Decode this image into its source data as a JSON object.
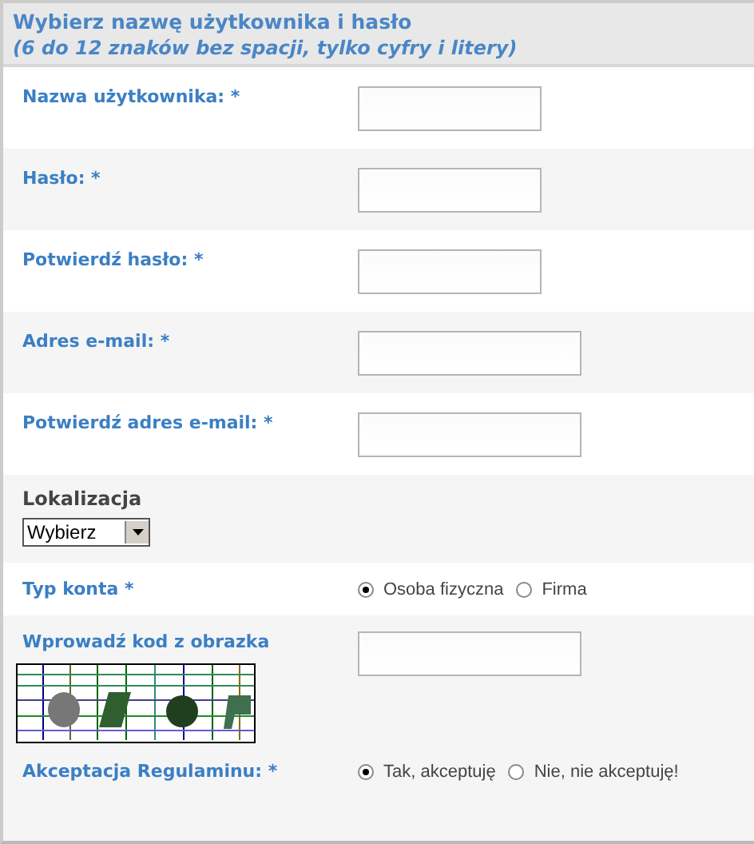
{
  "header": {
    "title": "Wybierz nazwę użytkownika i hasło",
    "subtitle": "(6 do 12 znaków bez spacji, tylko cyfry i litery)"
  },
  "rows": [
    {
      "kind": "text",
      "label": "Nazwa użytkownika: *"
    },
    {
      "kind": "text",
      "label": "Hasło: *"
    },
    {
      "kind": "text",
      "label": "Potwierdź hasło: *"
    },
    {
      "kind": "email",
      "label": "Adres e-mail: *"
    },
    {
      "kind": "email",
      "label": "Potwierdź adres e-mail: *"
    },
    {
      "kind": "select",
      "label": "Lokalizacja",
      "value": "Wybierz"
    },
    {
      "kind": "radio",
      "label": "Typ konta *",
      "options": [
        {
          "label": "Osoba fizyczna",
          "selected": true
        },
        {
          "label": "Firma",
          "selected": false
        }
      ]
    },
    {
      "kind": "captcha",
      "label": "Wprowadź kod z obrazka"
    },
    {
      "kind": "radio",
      "label": "Akceptacja Regulaminu: *",
      "options": [
        {
          "label": "Tak, akceptuję",
          "selected": true
        },
        {
          "label": "Nie, nie akceptuję!",
          "selected": false
        }
      ]
    }
  ]
}
